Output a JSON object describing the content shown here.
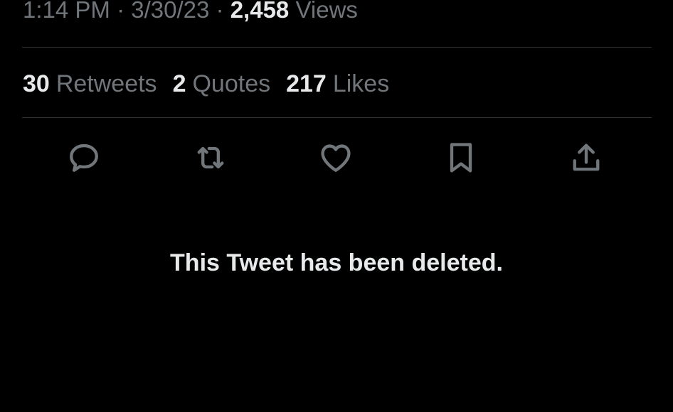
{
  "tweet_meta": {
    "time": "1:14 PM",
    "separator": "·",
    "date": "3/30/23",
    "views_count": "2,458",
    "views_label": "Views"
  },
  "stats": {
    "retweets": {
      "count": "30",
      "label": "Retweets"
    },
    "quotes": {
      "count": "2",
      "label": "Quotes"
    },
    "likes": {
      "count": "217",
      "label": "Likes"
    }
  },
  "actions": [
    {
      "name": "reply",
      "icon": "reply-icon"
    },
    {
      "name": "retweet",
      "icon": "retweet-icon"
    },
    {
      "name": "like",
      "icon": "heart-icon"
    },
    {
      "name": "bookmark",
      "icon": "bookmark-icon"
    },
    {
      "name": "share",
      "icon": "share-icon"
    }
  ],
  "notice": "This Tweet has been deleted.",
  "colors": {
    "background": "#000000",
    "primary_text": "#e7e9ea",
    "secondary_text": "#71767b",
    "divider": "#2f3336"
  }
}
